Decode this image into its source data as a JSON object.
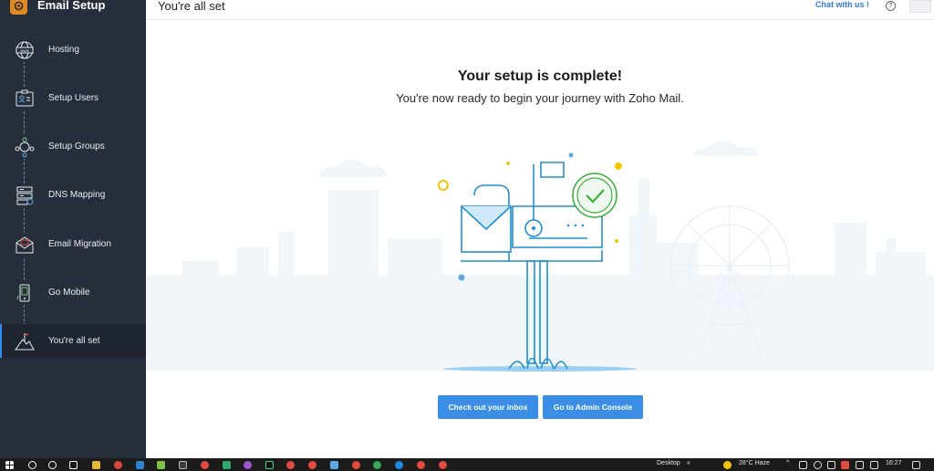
{
  "app": {
    "title": "Email Setup"
  },
  "header": {
    "title": "You're all set",
    "chat_label": "Chat with us !",
    "help_icon": "?"
  },
  "sidebar": {
    "items": [
      {
        "label": "Hosting",
        "icon": "www-globe-icon"
      },
      {
        "label": "Setup Users",
        "icon": "user-card-icon"
      },
      {
        "label": "Setup Groups",
        "icon": "group-icon"
      },
      {
        "label": "DNS Mapping",
        "icon": "server-icon"
      },
      {
        "label": "Email Migration",
        "icon": "envelope-icon"
      },
      {
        "label": "Go Mobile",
        "icon": "mobile-icon"
      },
      {
        "label": "You're all set",
        "icon": "flag-mountain-icon",
        "active": true
      }
    ]
  },
  "main": {
    "heading": "Your setup is complete!",
    "subheading": "You're now ready to begin your journey with Zoho Mail.",
    "buttons": {
      "inbox": "Check out your inbox",
      "admin": "Go to Admin Console"
    }
  },
  "taskbar": {
    "desktop_label": "Desktop",
    "chevron": "»",
    "weather": "28°C  Haze",
    "time": "16:27"
  },
  "colors": {
    "sidebar_bg": "#272e3b",
    "accent": "#3a8ee6",
    "check_green": "#3db03d",
    "mail_blue": "#1f8fd6"
  }
}
